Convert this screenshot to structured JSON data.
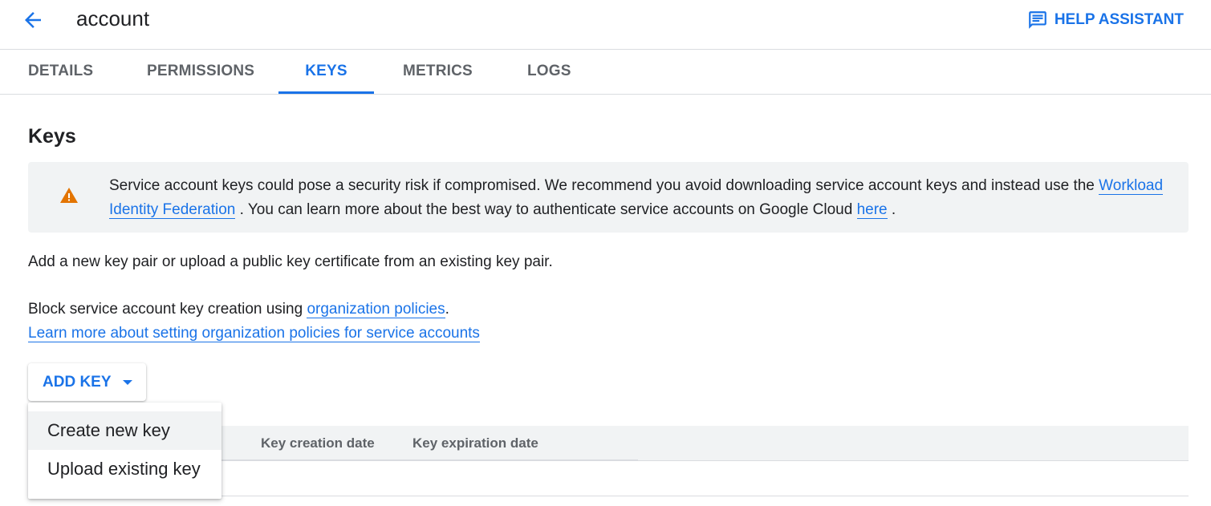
{
  "header": {
    "title": "account",
    "back_icon": "arrow-left-icon",
    "help_label": "HELP ASSISTANT",
    "help_icon": "chat-icon"
  },
  "tabs": [
    {
      "label": "DETAILS",
      "active": false
    },
    {
      "label": "PERMISSIONS",
      "active": false
    },
    {
      "label": "KEYS",
      "active": true
    },
    {
      "label": "METRICS",
      "active": false
    },
    {
      "label": "LOGS",
      "active": false
    }
  ],
  "section": {
    "heading": "Keys"
  },
  "warning": {
    "icon": "warning-icon",
    "text_1": "Service account keys could pose a security risk if compromised. We recommend you avoid downloading service account keys and instead use the ",
    "link_1": "Workload Identity Federation",
    "text_2": " . You can learn more about the best way to authenticate service accounts on Google Cloud ",
    "link_2": "here",
    "text_3": " ."
  },
  "intro": {
    "line_1": "Add a new key pair or upload a public key certificate from an existing key pair.",
    "line_2_prefix": "Block service account key creation using ",
    "line_2_link": "organization policies",
    "line_2_suffix": ".",
    "line_3_link": "Learn more about setting organization policies for service accounts"
  },
  "add_key": {
    "label": "ADD KEY",
    "caret_icon": "caret-down-icon"
  },
  "menu": {
    "items": [
      {
        "label": "Create new key",
        "highlighted": true
      },
      {
        "label": "Upload existing key",
        "highlighted": false
      }
    ]
  },
  "table": {
    "columns": [
      "Key creation date",
      "Key expiration date"
    ]
  },
  "colors": {
    "accent": "#1a73e8",
    "warning": "#e37400",
    "muted": "#5f6368",
    "panel": "#f1f3f4"
  }
}
